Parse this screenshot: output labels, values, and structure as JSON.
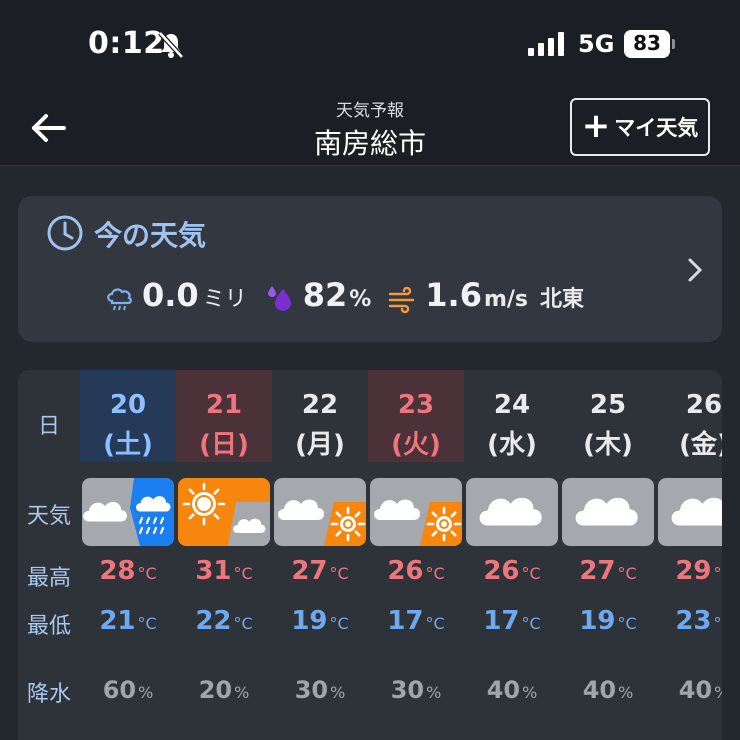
{
  "status": {
    "time": "0:12",
    "network": "5G",
    "battery": "83"
  },
  "nav": {
    "subtitle": "天気予報",
    "title": "南房総市",
    "my_weather_label": "マイ天気"
  },
  "current": {
    "title": "今の天気",
    "precip_value": "0.0",
    "precip_unit": "ミリ",
    "humidity_value": "82",
    "humidity_unit": "%",
    "wind_value": "1.6",
    "wind_unit": "m/s",
    "wind_dir": "北東"
  },
  "table": {
    "labels": {
      "day": "日",
      "weather": "天気",
      "high": "最高",
      "low": "最低",
      "precip": "降水"
    },
    "temp_unit": "°C",
    "pct_unit": "%",
    "days": [
      {
        "date": "20",
        "weekday": "(土)",
        "type": "sat",
        "icon": "cloud-then-rain",
        "high": "28",
        "low": "21",
        "pop": "60"
      },
      {
        "date": "21",
        "weekday": "(日)",
        "type": "hol",
        "icon": "sun-then-cloud",
        "high": "31",
        "low": "22",
        "pop": "20"
      },
      {
        "date": "22",
        "weekday": "(月)",
        "type": "week",
        "icon": "cloud-then-sun",
        "high": "27",
        "low": "19",
        "pop": "30"
      },
      {
        "date": "23",
        "weekday": "(火)",
        "type": "hol",
        "icon": "cloud-then-sun",
        "high": "26",
        "low": "17",
        "pop": "30"
      },
      {
        "date": "24",
        "weekday": "(水)",
        "type": "week",
        "icon": "cloud",
        "high": "26",
        "low": "17",
        "pop": "40"
      },
      {
        "date": "25",
        "weekday": "(木)",
        "type": "week",
        "icon": "cloud",
        "high": "27",
        "low": "19",
        "pop": "40"
      },
      {
        "date": "26",
        "weekday": "(金)",
        "type": "week",
        "icon": "cloud",
        "high": "29",
        "low": "23",
        "pop": "40"
      }
    ]
  },
  "colors": {
    "accent": "#9fc3ef",
    "high": "#f0747c",
    "low": "#6ea8ef",
    "sat": "#8ec0ff",
    "holiday": "#f0747c",
    "sun": "#f7860f",
    "rain": "#1c7ff0"
  }
}
